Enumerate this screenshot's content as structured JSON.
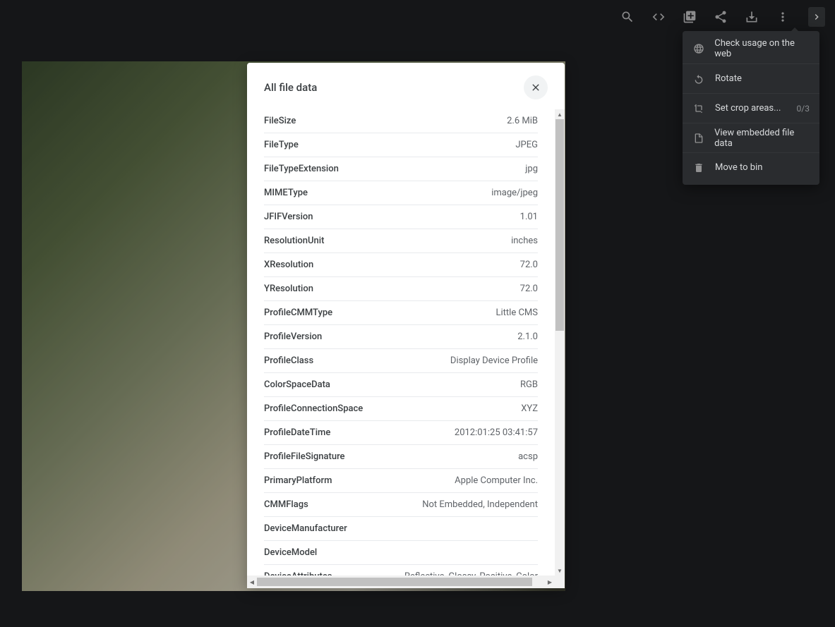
{
  "toolbar": {
    "search_icon": "search-icon",
    "code_icon": "code-icon",
    "add_icon": "add-to-collection-icon",
    "share_icon": "share-icon",
    "download_icon": "download-icon",
    "more_icon": "more-icon",
    "chevron_icon": "chevron-right-icon"
  },
  "modal": {
    "title": "All file data",
    "rows": [
      {
        "key": "FileSize",
        "value": "2.6 MiB"
      },
      {
        "key": "FileType",
        "value": "JPEG"
      },
      {
        "key": "FileTypeExtension",
        "value": "jpg"
      },
      {
        "key": "MIMEType",
        "value": "image/jpeg"
      },
      {
        "key": "JFIFVersion",
        "value": "1.01"
      },
      {
        "key": "ResolutionUnit",
        "value": "inches"
      },
      {
        "key": "XResolution",
        "value": "72.0"
      },
      {
        "key": "YResolution",
        "value": "72.0"
      },
      {
        "key": "ProfileCMMType",
        "value": "Little CMS"
      },
      {
        "key": "ProfileVersion",
        "value": "2.1.0"
      },
      {
        "key": "ProfileClass",
        "value": "Display Device Profile"
      },
      {
        "key": "ColorSpaceData",
        "value": "RGB"
      },
      {
        "key": "ProfileConnectionSpace",
        "value": "XYZ"
      },
      {
        "key": "ProfileDateTime",
        "value": "2012:01:25 03:41:57"
      },
      {
        "key": "ProfileFileSignature",
        "value": "acsp"
      },
      {
        "key": "PrimaryPlatform",
        "value": "Apple Computer Inc."
      },
      {
        "key": "CMMFlags",
        "value": "Not Embedded, Independent"
      },
      {
        "key": "DeviceManufacturer",
        "value": ""
      },
      {
        "key": "DeviceModel",
        "value": ""
      },
      {
        "key": "DeviceAttributes",
        "value": "Reflective, Glossy, Positive, Color"
      }
    ]
  },
  "context_menu": {
    "items": [
      {
        "label": "Check usage on the web",
        "icon": "globe-icon"
      },
      {
        "label": "Rotate",
        "icon": "rotate-icon"
      },
      {
        "label": "Set crop areas...",
        "icon": "crop-icon",
        "trailing": "0/3"
      },
      {
        "label": "View embedded file data",
        "icon": "file-icon"
      },
      {
        "label": "Move to bin",
        "icon": "trash-icon"
      }
    ]
  }
}
